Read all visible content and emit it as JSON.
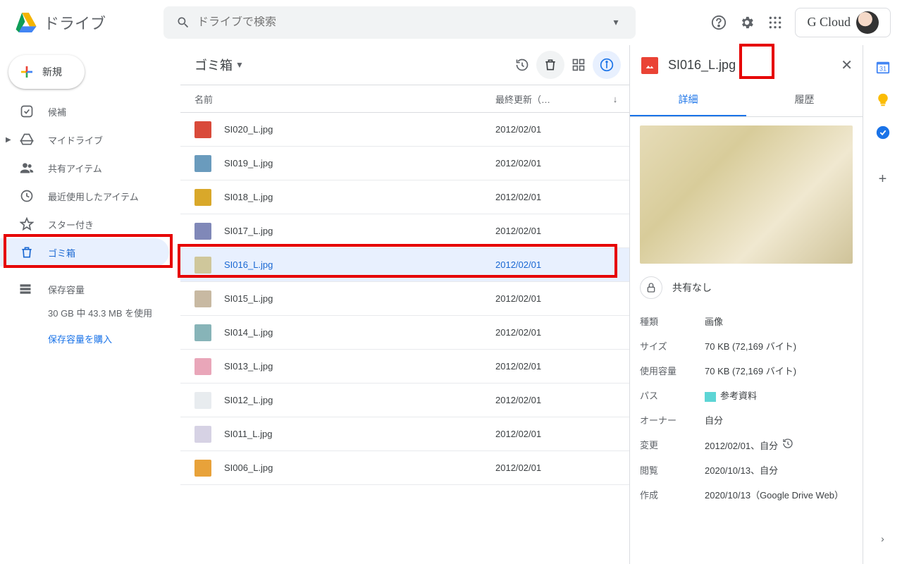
{
  "header": {
    "app_name": "ドライブ",
    "search_placeholder": "ドライブで検索",
    "account_label": "G Cloud"
  },
  "sidebar": {
    "new_label": "新規",
    "items": [
      {
        "label": "候補"
      },
      {
        "label": "マイドライブ"
      },
      {
        "label": "共有アイテム"
      },
      {
        "label": "最近使用したアイテム"
      },
      {
        "label": "スター付き"
      },
      {
        "label": "ゴミ箱"
      }
    ],
    "storage": {
      "label": "保存容量",
      "used": "30 GB 中 43.3 MB を使用",
      "buy": "保存容量を購入"
    }
  },
  "toolbar": {
    "breadcrumb": "ゴミ箱"
  },
  "table": {
    "col_name": "名前",
    "col_date": "最終更新（…"
  },
  "files": [
    {
      "name": "SI020_L.jpg",
      "date": "2012/02/01",
      "color": "#d94a3a"
    },
    {
      "name": "SI019_L.jpg",
      "date": "2012/02/01",
      "color": "#6a9bbd"
    },
    {
      "name": "SI018_L.jpg",
      "date": "2012/02/01",
      "color": "#d9a82a"
    },
    {
      "name": "SI017_L.jpg",
      "date": "2012/02/01",
      "color": "#8088b8"
    },
    {
      "name": "SI016_L.jpg",
      "date": "2012/02/01",
      "color": "#cfc79b"
    },
    {
      "name": "SI015_L.jpg",
      "date": "2012/02/01",
      "color": "#c8b9a2"
    },
    {
      "name": "SI014_L.jpg",
      "date": "2012/02/01",
      "color": "#87b4b8"
    },
    {
      "name": "SI013_L.jpg",
      "date": "2012/02/01",
      "color": "#e9a6b9"
    },
    {
      "name": "SI012_L.jpg",
      "date": "2012/02/01",
      "color": "#e8ecef"
    },
    {
      "name": "SI011_L.jpg",
      "date": "2012/02/01",
      "color": "#d6d2e4"
    },
    {
      "name": "SI006_L.jpg",
      "date": "2012/02/01",
      "color": "#e8a23a"
    }
  ],
  "details": {
    "title": "SI016_L.jpg",
    "tabs": {
      "details": "詳細",
      "history": "履歴"
    },
    "share_none": "共有なし",
    "meta": {
      "type_k": "種類",
      "type_v": "画像",
      "size_k": "サイズ",
      "size_v": "70 KB (72,169 バイト)",
      "usage_k": "使用容量",
      "usage_v": "70 KB (72,169 バイト)",
      "path_k": "パス",
      "path_v": "参考資料",
      "owner_k": "オーナー",
      "owner_v": "自分",
      "mod_k": "変更",
      "mod_v": "2012/02/01、自分",
      "view_k": "閲覧",
      "view_v": "2020/10/13、自分",
      "create_k": "作成",
      "create_v": "2020/10/13（Google Drive Web）"
    }
  }
}
